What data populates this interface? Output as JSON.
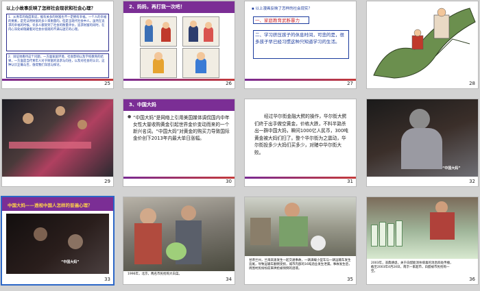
{
  "slides": [
    {
      "number": "25",
      "title": "以上小故事反映了怎样社会现状和社会心理？",
      "para1": "1．从青年的角度来说，据有关多的财富也不一定拥有幸福，一个人的幸福的要素，是无法用财富的多少来衡量的。但是当现代社会中人，虽然在追求的幸福的时候，许多人都受到了社会的衡量评价，追求财富的同时，在内心深处却隐藏着对社会价值观的不满与迷茫的心理。",
      "para2": "2．辩证地看待这个问题，一方面家庭环境、社会影响以及学校教育的结果，一方面是当代青年人对于财富的追求与向往，以及对社会的认识，这种认识正确与否，值得我们深思与探讨。"
    },
    {
      "number": "26",
      "title": "2、妈妈，再打我一次吧！"
    },
    {
      "number": "27",
      "question": "以上漫画反映了怎样的社会现实？",
      "item1": "一、家庭教育武断暴力",
      "item2": "二、学习挤压孩子的休息时间，可悲的是，很多孩子早已经习惯这种只知道学习的生活。"
    },
    {
      "number": "28"
    },
    {
      "number": "29"
    },
    {
      "number": "30",
      "title": "3、中国大妈",
      "body": "“中国大妈”是网络上引用美国媒体调侃国内中年女性大量收购黄金引起世界金价变动而来的一个新兴名词。“中国大妈”对黄金的购买力导致国际金价创下2013年内最大单日涨幅。"
    },
    {
      "number": "31",
      "body": "经过华尔街金融大鳄的操作，华尔街大鳄们终于出手做空黄金，价格大跌，不料半路杀出一群中国大妈，瞬间1000亿人民币，300吨黄金被大妈们扫了。整个华尔街为之震动，华尔街投多少大妈们买多少，对赌中华尔街大败。"
    },
    {
      "number": "32",
      "label": "“中国大妈”"
    },
    {
      "number": "33",
      "title": "中国大妈——透视中国人怎样的普遍心理？",
      "label": "“中国大妈”"
    },
    {
      "number": "34",
      "caption": "1996年，北京，两名市民抢购大白菜。"
    },
    {
      "number": "35",
      "caption": "甘肃兰州，兰海高速发生一起交通事故，一辆满载小型车与一辆运输车发生追尾，导致运输车翻侧受损，城市内部的16吨酒业发生泄漏。事故发生后，周围村民纷纷前来哄抢被倾倒的酒液。"
    },
    {
      "number": "36",
      "caption": "2003年，非典肆虐，关于白醋能消杀病毒的消息四处传播，截至2003年4月24日，南京一家超市，白醋被市民抢购一空。"
    }
  ],
  "colors": {
    "purple": "#7b2e95",
    "red": "#c8222a",
    "blue": "#1a3a9c",
    "selection": "#2b66c7"
  }
}
